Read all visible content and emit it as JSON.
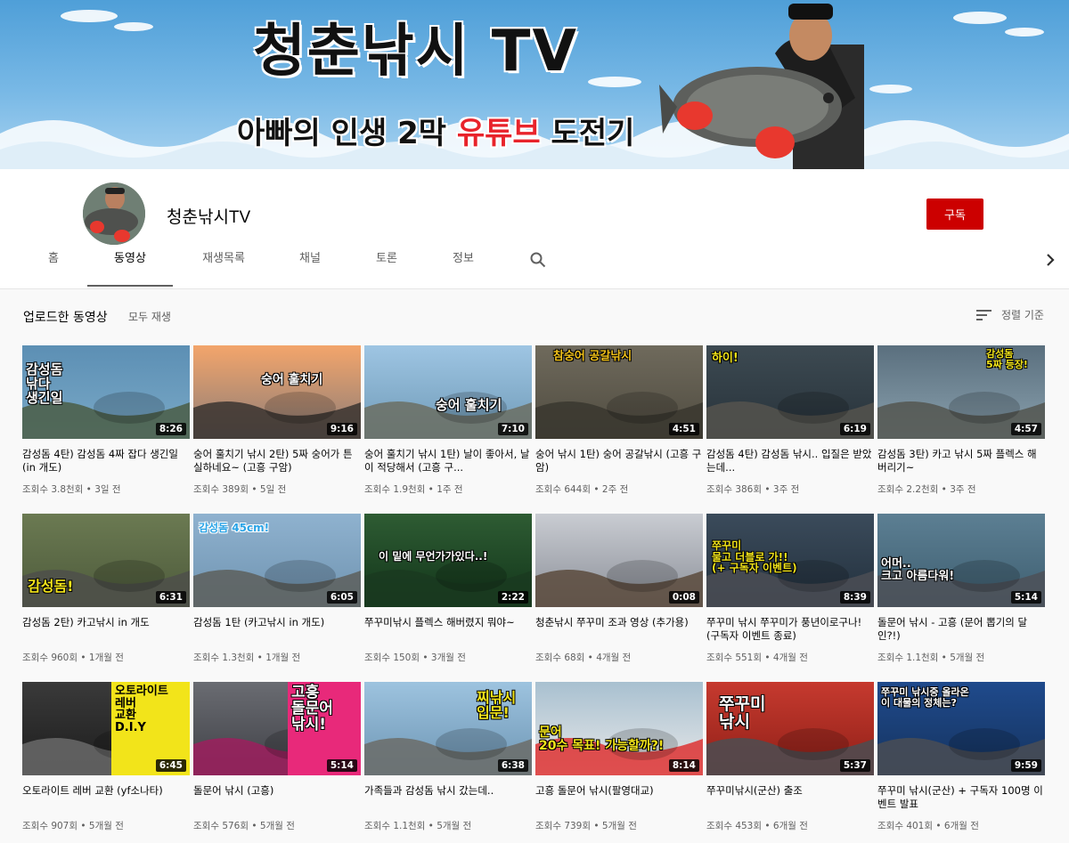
{
  "banner": {
    "title": "청춘낚시 TV",
    "subtitle_pre": "아빠의 인생 2막 ",
    "subtitle_hl": "유튜브",
    "subtitle_post": " 도전기"
  },
  "channel": {
    "name": "청춘낚시TV",
    "subscribe_label": "구독"
  },
  "tabs": [
    {
      "label": "홈"
    },
    {
      "label": "동영상"
    },
    {
      "label": "재생목록"
    },
    {
      "label": "채널"
    },
    {
      "label": "토론"
    },
    {
      "label": "정보"
    }
  ],
  "section": {
    "title": "업로드한 동영상",
    "play_all": "모두 재생",
    "sort_label": "정렬 기준"
  },
  "colors": {
    "accent": "#cc0000",
    "banner_highlight": "#e8232b"
  },
  "videos": [
    {
      "title": "감성돔 4탄) 감성돔 4짜 잡다 생긴일 (in 개도)",
      "meta": "조회수 3.8천회 • 3일 전",
      "duration": "8:26",
      "thumb_text": "감성돔\n낚다\n생긴일"
    },
    {
      "title": "숭어 훌치기 낚시 2탄) 5짜 숭어가 튼실하네요~ (고흥 구암)",
      "meta": "조회수 389회 • 5일 전",
      "duration": "9:16",
      "thumb_text": "숭어 훌치기"
    },
    {
      "title": "숭어 훌치기 낚시 1탄) 날이 좋아서, 날이 적당해서 (고흥 구...",
      "meta": "조회수 1.9천회 • 1주 전",
      "duration": "7:10",
      "thumb_text": "숭어 훌치기"
    },
    {
      "title": "숭어 낚시 1탄) 숭어 공갈낚시 (고흥 구암)",
      "meta": "조회수 644회 • 2주 전",
      "duration": "4:51",
      "thumb_text": "참숭어 공갈낚시"
    },
    {
      "title": "감성돔 4탄) 감성돔 낚시.. 입질은 받았는데...",
      "meta": "조회수 386회 • 3주 전",
      "duration": "6:19",
      "thumb_text": "하이!"
    },
    {
      "title": "감성돔 3탄) 카고 낚시 5짜 플렉스 해버리기~",
      "meta": "조회수 2.2천회 • 3주 전",
      "duration": "4:57",
      "thumb_text": "감성돔\n5짜 등장!"
    },
    {
      "title": "감성돔 2탄) 카고낚시 in 개도",
      "meta": "조회수 960회 • 1개월 전",
      "duration": "6:31",
      "thumb_text": "감성돔!"
    },
    {
      "title": "감성돔 1탄 (카고낚시 in 개도)",
      "meta": "조회수 1.3천회 • 1개월 전",
      "duration": "6:05",
      "thumb_text": "감성돔 45cm!"
    },
    {
      "title": "쭈꾸미낚시 플렉스 해버렸지 뭐야~",
      "meta": "조회수 150회 • 3개월 전",
      "duration": "2:22",
      "thumb_text": "이 밑에 무언가가있다..!"
    },
    {
      "title": "청춘낚시 쭈꾸미 조과 영상 (추가용)",
      "meta": "조회수 68회 • 4개월 전",
      "duration": "0:08",
      "thumb_text": ""
    },
    {
      "title": "쭈꾸미 낚시 쭈꾸미가 풍년이로구나! (구독자 이벤트 종료)",
      "meta": "조회수 551회 • 4개월 전",
      "duration": "8:39",
      "thumb_text": "쭈꾸미\n물고 더블로 가!!\n(+ 구독자 이벤트)"
    },
    {
      "title": "돌문어 낚시 - 고흥 (문어 뽑기의 달인?!)",
      "meta": "조회수 1.1천회 • 5개월 전",
      "duration": "5:14",
      "thumb_text": "어머..\n크고 아름다워!"
    },
    {
      "title": "오토라이트 레버 교환 (yf소나타)",
      "meta": "조회수 907회 • 5개월 전",
      "duration": "6:45",
      "thumb_text": "오토라이트\n레버\n교환\nD.I.Y"
    },
    {
      "title": "돌문어 낚시 (고흥)",
      "meta": "조회수 576회 • 5개월 전",
      "duration": "5:14",
      "thumb_text": "고흥\n돌문어\n낚시!"
    },
    {
      "title": "가족들과 감성돔 낚시 갔는데..",
      "meta": "조회수 1.1천회 • 5개월 전",
      "duration": "6:38",
      "thumb_text": "찌낚시\n입문!"
    },
    {
      "title": "고흥 돌문어 낚시(팔영대교)",
      "meta": "조회수 739회 • 5개월 전",
      "duration": "8:14",
      "thumb_text": "문어\n20수 목표! 가능할까?!"
    },
    {
      "title": "쭈꾸미낚시(군산) 출조",
      "meta": "조회수 453회 • 6개월 전",
      "duration": "5:37",
      "thumb_text": "쭈꾸미\n낚시"
    },
    {
      "title": "쭈꾸미 낚시(군산) + 구독자 100명 이벤트 발표",
      "meta": "조회수 401회 • 6개월 전",
      "duration": "9:59",
      "thumb_text": "쭈꾸미 낚시중 올라온\n이 대물의 정체는?"
    }
  ]
}
